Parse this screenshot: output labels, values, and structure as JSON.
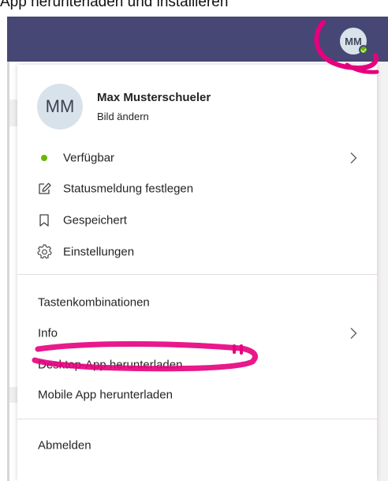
{
  "caption": "App herunterladen und installieren",
  "profile": {
    "initials": "MM",
    "name": "Max Musterschueler",
    "change_picture": "Bild ändern"
  },
  "status_menu": [
    {
      "label": "Verfügbar",
      "icon": "available-dot",
      "has_submenu": true
    },
    {
      "label": "Statusmeldung festlegen",
      "icon": "edit-icon",
      "has_submenu": false
    },
    {
      "label": "Gespeichert",
      "icon": "bookmark-icon",
      "has_submenu": false
    },
    {
      "label": "Einstellungen",
      "icon": "gear-icon",
      "has_submenu": false
    }
  ],
  "secondary_menu": [
    {
      "label": "Tastenkombinationen",
      "has_submenu": false
    },
    {
      "label": "Info",
      "has_submenu": true
    },
    {
      "label": "Desktop-App herunterladen",
      "has_submenu": false
    },
    {
      "label": "Mobile App herunterladen",
      "has_submenu": false
    }
  ],
  "sign_out": "Abmelden",
  "colors": {
    "header": "#464775",
    "available": "#6bb700",
    "annotation": "#e5007e"
  }
}
